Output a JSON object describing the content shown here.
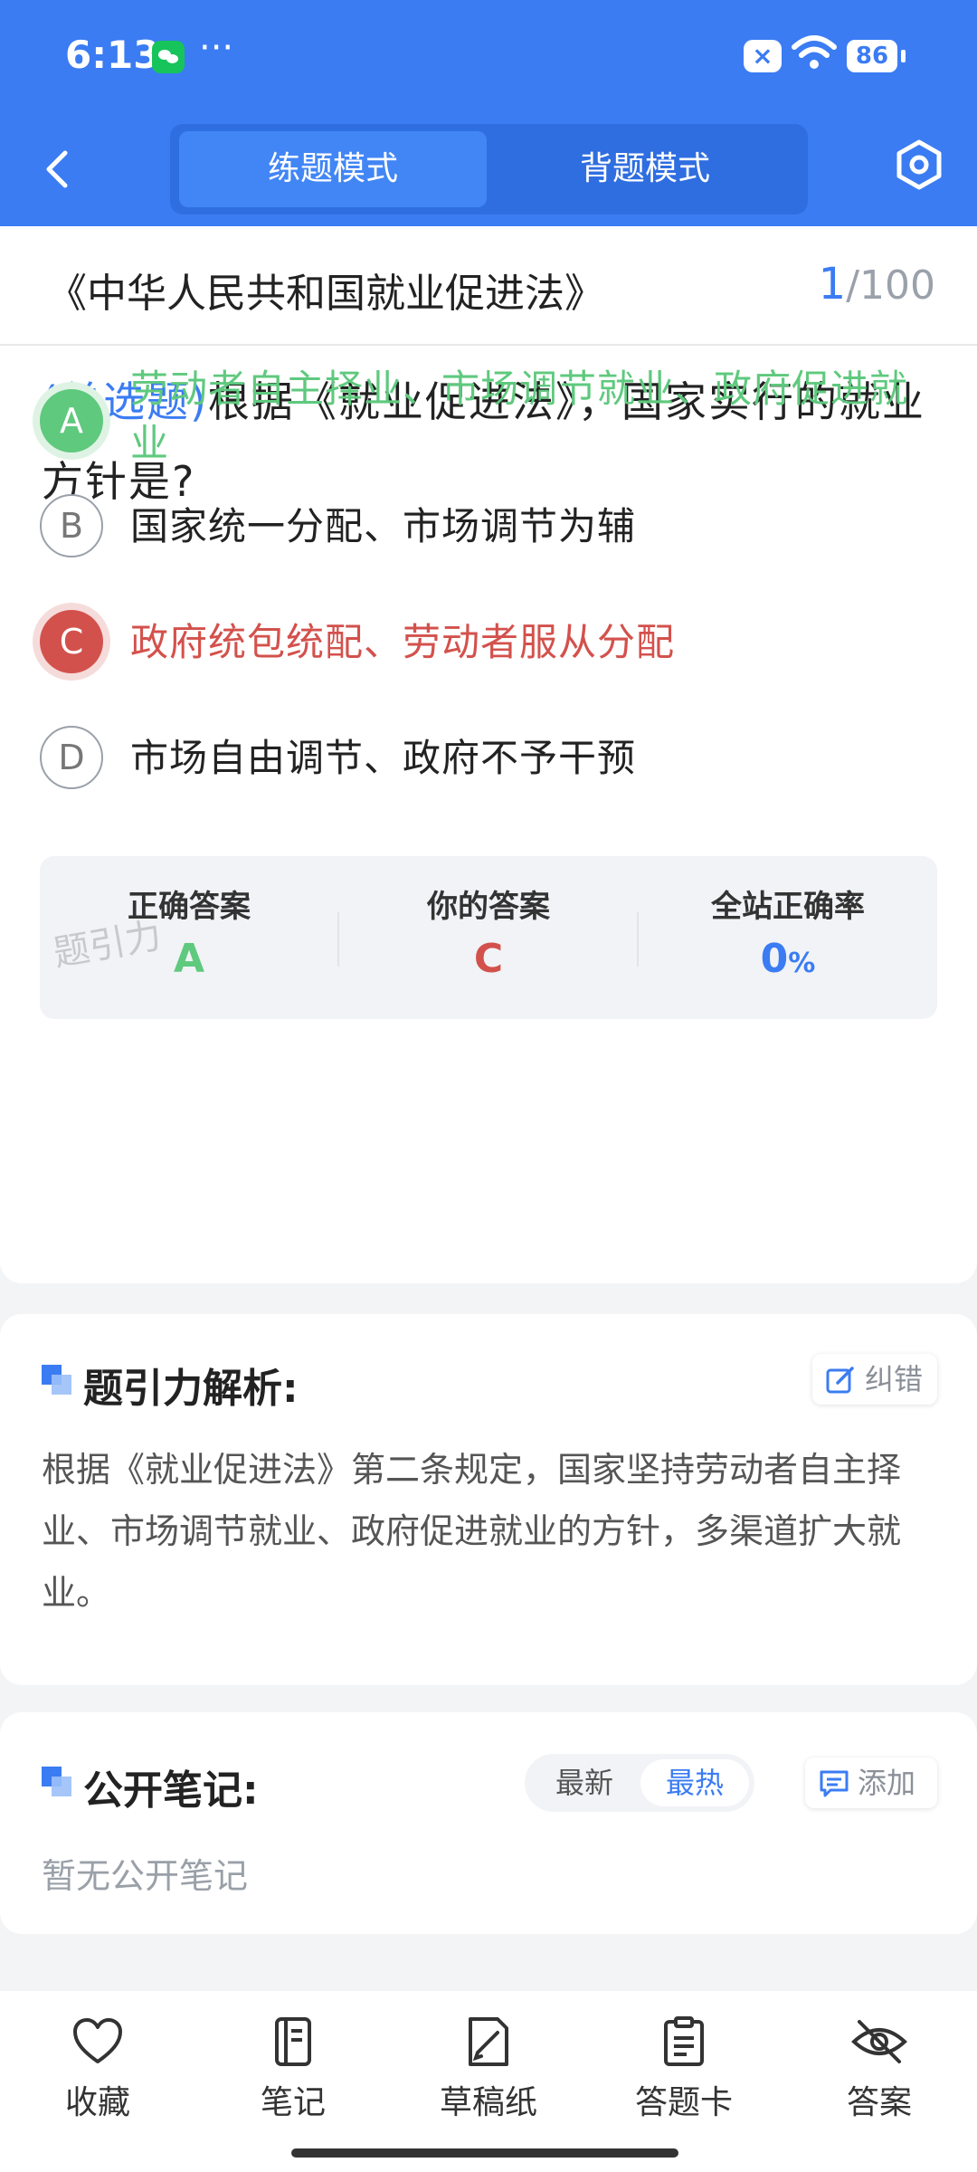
{
  "status_bar": {
    "time": "6:13",
    "dots": "···",
    "battery": "86"
  },
  "nav": {
    "tabs": [
      "练题模式",
      "背题模式"
    ]
  },
  "chapter": {
    "title": "《中华人民共和国就业促进法》",
    "current": "1",
    "total": "/100"
  },
  "question": {
    "type": "(单选题)",
    "text": "根据《就业促进法》，国家实行的就业方针是?"
  },
  "options": [
    {
      "letter": "A",
      "text": "劳动者自主择业、市场调节就业、政府促进就业",
      "state": "correct"
    },
    {
      "letter": "B",
      "text": "国家统一分配、市场调节为辅",
      "state": "normal"
    },
    {
      "letter": "C",
      "text": "政府统包统配、劳动者服从分配",
      "state": "wrong"
    },
    {
      "letter": "D",
      "text": "市场自由调节、政府不予干预",
      "state": "normal"
    }
  ],
  "stats": {
    "correct_label": "正确答案",
    "correct_value": "A",
    "yours_label": "你的答案",
    "yours_value": "C",
    "rate_label": "全站正确率",
    "rate_value": "0",
    "rate_unit": "%"
  },
  "watermark": "题引力",
  "analysis": {
    "title": "题引力解析:",
    "report_label": "纠错",
    "body": "根据《就业促进法》第二条规定，国家坚持劳动者自主择业、市场调节就业、政府促进就业的方针，多渠道扩大就业。"
  },
  "notes": {
    "title": "公开笔记:",
    "sort_options": [
      "最新",
      "最热"
    ],
    "add_label": "添加",
    "empty_text": "暂无公开笔记"
  },
  "bottom_bar": [
    "收藏",
    "笔记",
    "草稿纸",
    "答题卡",
    "答案"
  ],
  "colors": {
    "primary": "#3b7cf3",
    "correct": "#5fc97e",
    "wrong": "#d3514c"
  }
}
